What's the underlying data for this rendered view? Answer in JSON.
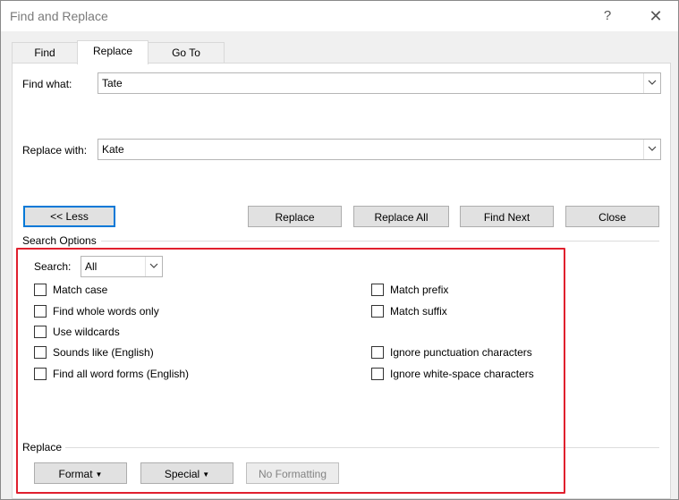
{
  "window": {
    "title": "Find and Replace",
    "help_glyph": "?",
    "close_glyph": "✕"
  },
  "tabs": [
    {
      "label": "Find"
    },
    {
      "label": "Replace"
    },
    {
      "label": "Go To"
    }
  ],
  "find": {
    "label": "Find what:",
    "value": "Tate"
  },
  "replace": {
    "label": "Replace with:",
    "value": "Kate"
  },
  "buttons": {
    "less": "<< Less",
    "replace": "Replace",
    "replace_all": "Replace All",
    "find_next": "Find Next",
    "close": "Close"
  },
  "search_options": {
    "title": "Search Options",
    "search_label": "Search:",
    "search_value": "All",
    "left_checks": [
      {
        "label": "Match case",
        "checked": false
      },
      {
        "label": "Find whole words only",
        "checked": false
      },
      {
        "label": "Use wildcards",
        "checked": false
      },
      {
        "label": "Sounds like (English)",
        "checked": false
      },
      {
        "label": "Find all word forms (English)",
        "checked": false
      }
    ],
    "right_checks": [
      {
        "label": "Match prefix",
        "checked": false
      },
      {
        "label": "Match suffix",
        "checked": false
      },
      {
        "label": "Ignore punctuation characters",
        "checked": false
      },
      {
        "label": "Ignore white-space characters",
        "checked": false
      }
    ]
  },
  "replace_section": {
    "title": "Replace",
    "format": "Format",
    "special": "Special",
    "no_formatting": "No Formatting"
  },
  "colors": {
    "highlight": "#e0202e",
    "default_button_border": "#0078d7"
  }
}
